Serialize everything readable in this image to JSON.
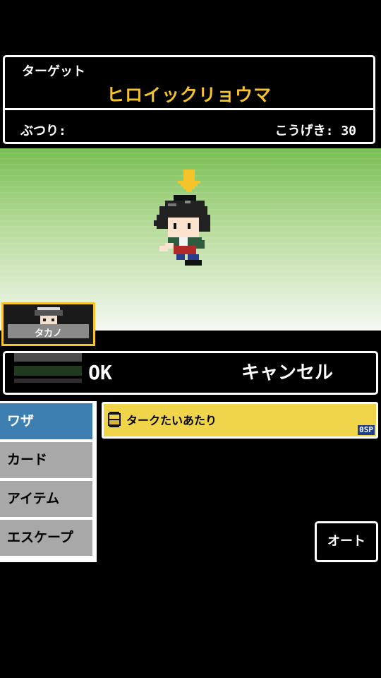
{
  "target": {
    "label": "ターゲット",
    "name": "ヒロイックリョウマ",
    "attribute_label": "ぶつり:",
    "attack_label": "こうげき: 30"
  },
  "party": {
    "members": [
      {
        "name": "タカノ"
      }
    ]
  },
  "confirm": {
    "ok_label": "OK",
    "cancel_label": "キャンセル"
  },
  "commands": [
    {
      "label": "ワザ",
      "active": true
    },
    {
      "label": "カード",
      "active": false
    },
    {
      "label": "アイテム",
      "active": false
    },
    {
      "label": "エスケープ",
      "active": false
    }
  ],
  "skills": [
    {
      "name": "タークたいあたり",
      "cost": "0",
      "cost_unit": "SP"
    }
  ],
  "auto_label": "オート",
  "colors": {
    "accent_yellow": "#f5c42a",
    "active_command": "#3d7fb0",
    "inactive_command": "#a8a8a8",
    "skill_bg": "#f0d54a",
    "field_top": "#78bf52"
  },
  "icons": {
    "target_marker": "down-arrow-icon",
    "skill_type": "skill-orb-icon"
  }
}
